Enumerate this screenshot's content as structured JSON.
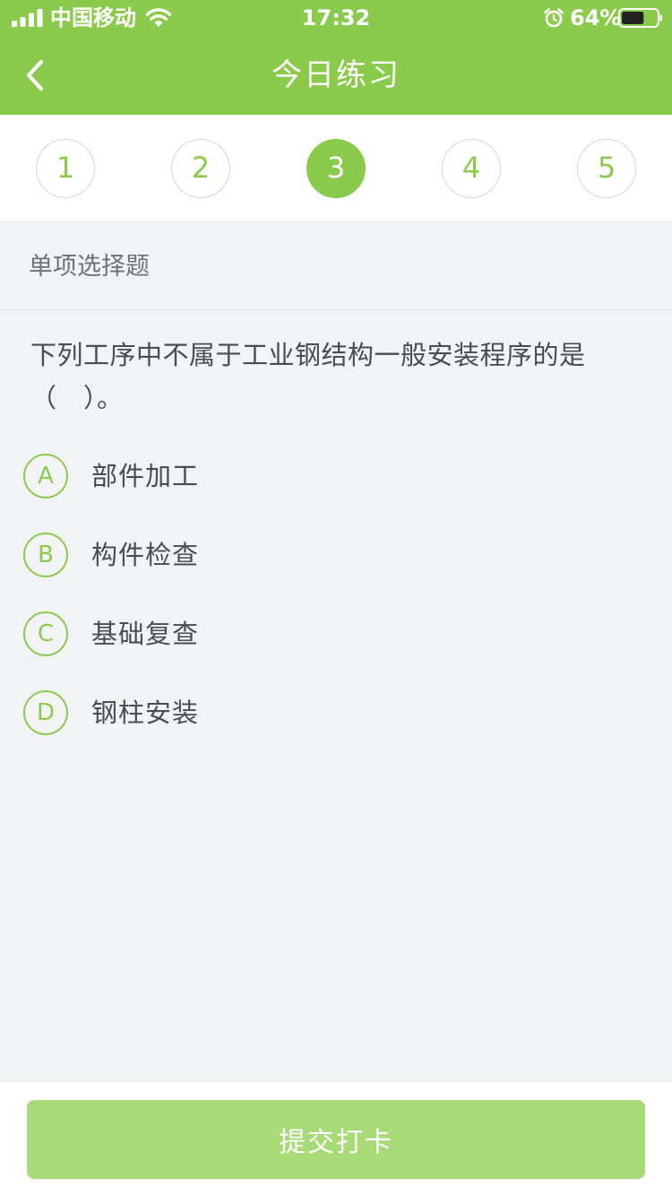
{
  "status_bar": {
    "carrier": "中国移动",
    "time": "17:32",
    "battery_percent": "64%",
    "battery_level": 0.64,
    "icons": [
      "signal-icon",
      "wifi-icon",
      "alarm-icon",
      "battery-icon"
    ]
  },
  "nav": {
    "title": "今日练习",
    "back_icon": "chevron-left-icon"
  },
  "steps": {
    "items": [
      "1",
      "2",
      "3",
      "4",
      "5"
    ],
    "active_index": 2
  },
  "question": {
    "type": "单项选择题",
    "text": "下列工序中不属于工业钢结构一般安装程序的是（　）。",
    "options": [
      {
        "letter": "A",
        "text": "部件加工"
      },
      {
        "letter": "B",
        "text": "构件检查"
      },
      {
        "letter": "C",
        "text": "基础复查"
      },
      {
        "letter": "D",
        "text": "钢柱安装"
      }
    ]
  },
  "footer": {
    "submit_label": "提交打卡"
  },
  "colors": {
    "brand_green": "#8bcb4c",
    "button_disabled_green": "#a8db78",
    "page_background": "#f2f3f5"
  }
}
